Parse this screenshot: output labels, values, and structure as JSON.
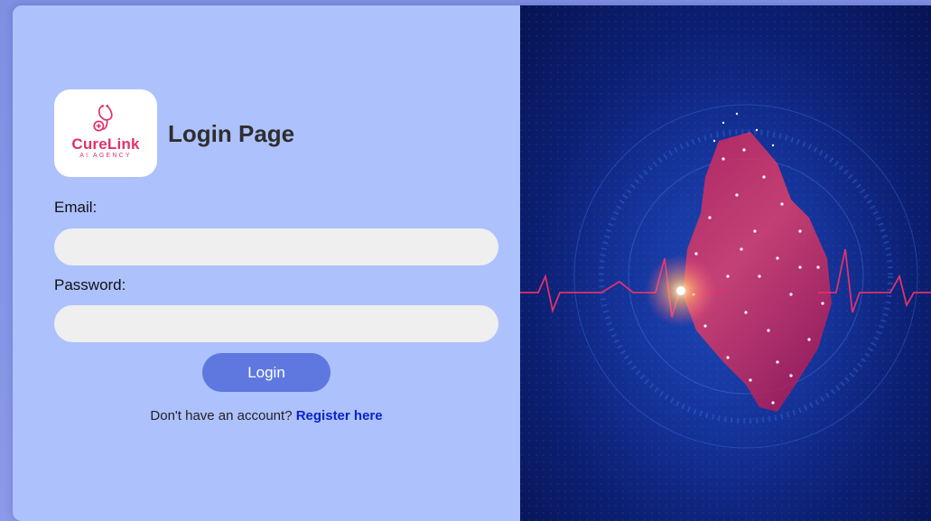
{
  "logo": {
    "name": "CureLink",
    "tagline": "AI AGENCY",
    "icon": "stethoscope-icon",
    "brand_color": "#e0326a"
  },
  "page": {
    "title": "Login Page"
  },
  "form": {
    "email_label": "Email:",
    "email_value": "",
    "password_label": "Password:",
    "password_value": "",
    "login_label": "Login",
    "register_prompt": "Don't have an account?",
    "register_link": "Register here"
  },
  "hero": {
    "image": "heart-ecg-illustration"
  },
  "colors": {
    "panel": "#adc1fd",
    "button": "#5f78e0",
    "link": "#0a23c8",
    "input": "#efefef"
  }
}
